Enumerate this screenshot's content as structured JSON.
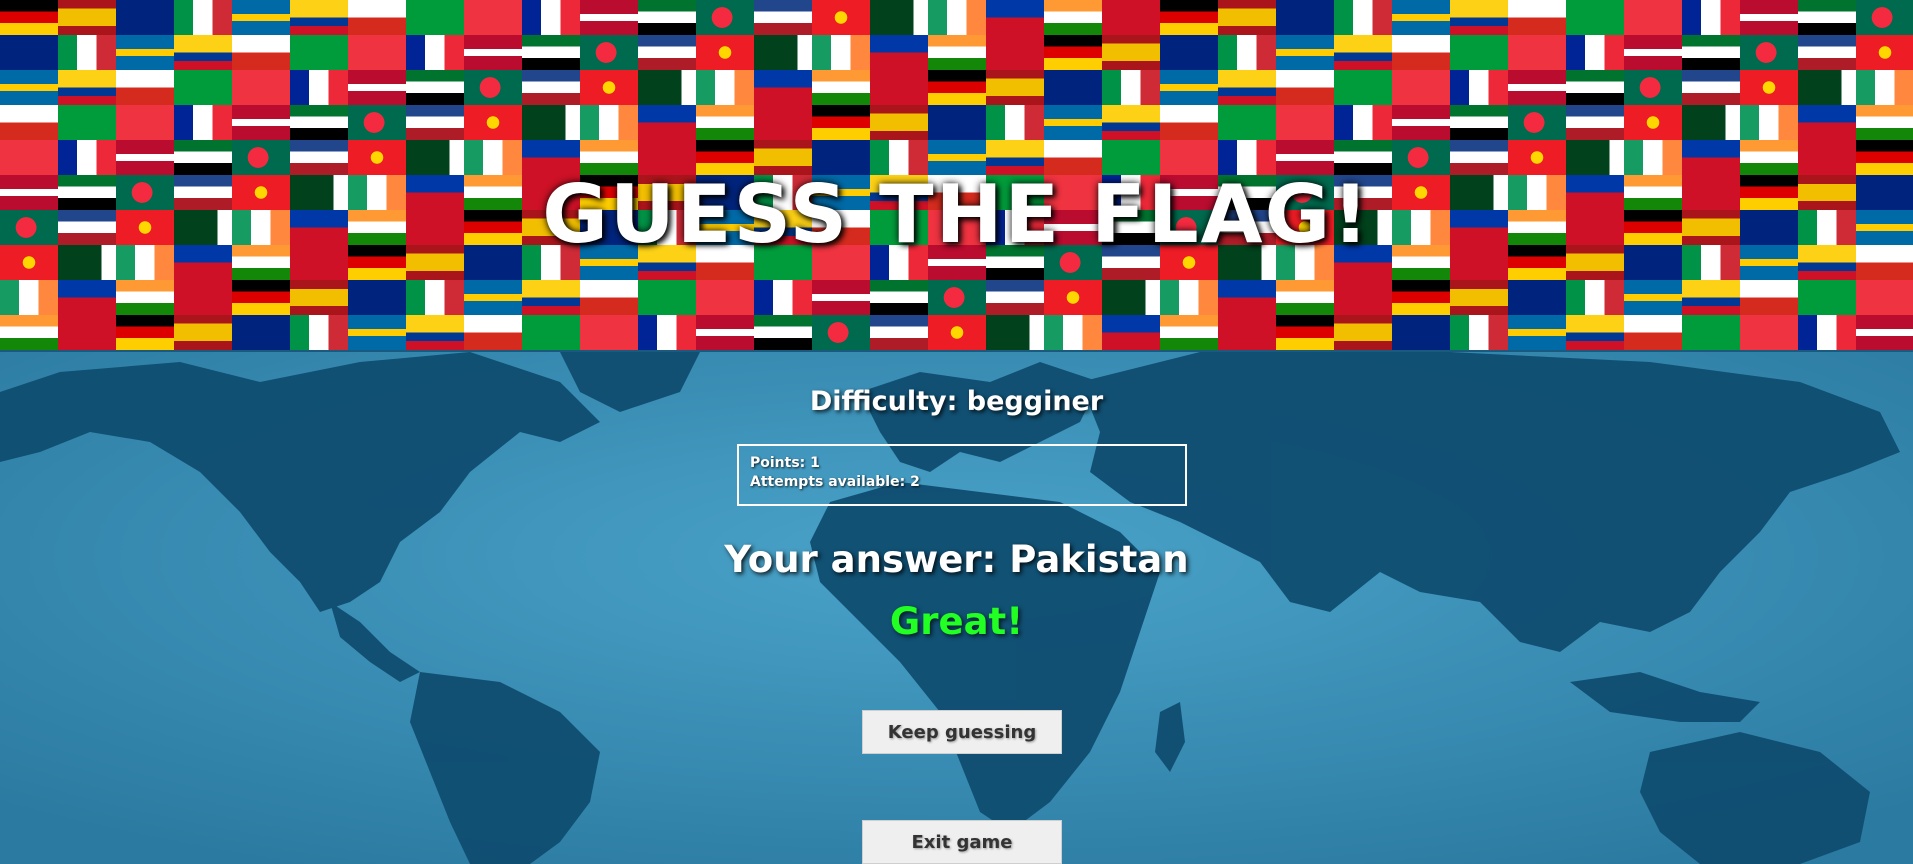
{
  "title": "GUESS THE FLAG!",
  "difficulty_text": "Difficulty: begginer",
  "stats": {
    "points_text": "Points: 1",
    "attempts_text": "Attempts available: 2"
  },
  "answer_text": "Your answer: Pakistan",
  "result_text": "Great!",
  "buttons": {
    "keep_guessing": "Keep guessing",
    "exit_game": "Exit game"
  },
  "colors": {
    "result": "#22ff22",
    "ocean": "#2f7fa6",
    "land": "#0e4a6c"
  }
}
